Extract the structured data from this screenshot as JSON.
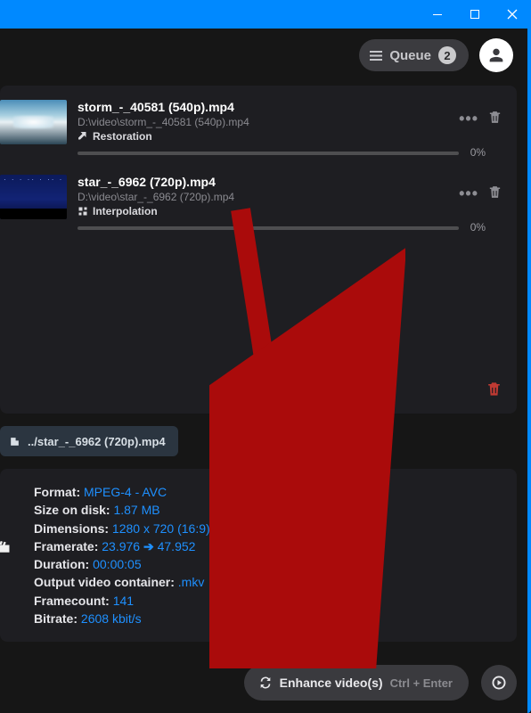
{
  "toolbar": {
    "queue_label": "Queue",
    "queue_count": "2"
  },
  "items": [
    {
      "name": "storm_-_40581 (540p).mp4",
      "path": "D:\\video\\storm_-_40581 (540p).mp4",
      "mode": "Restoration",
      "progress": "0%"
    },
    {
      "name": "star_-_6962 (720p).mp4",
      "path": "D:\\video\\star_-_6962 (720p).mp4",
      "mode": "Interpolation",
      "progress": "0%"
    }
  ],
  "selected_file": "../star_-_6962 (720p).mp4",
  "details": {
    "format_label": "Format:",
    "format": "MPEG-4 - AVC",
    "size_label": "Size on disk:",
    "size": "1.87 MB",
    "dim_label": "Dimensions:",
    "dim": "1280 x 720 (16:9)",
    "fps_label": "Framerate:",
    "fps_from": "23.976",
    "fps_to": "47.952",
    "dur_label": "Duration:",
    "dur": "00:00:05",
    "container_label": "Output video container:",
    "container": ".mkv",
    "fc_label": "Framecount:",
    "fc": "141",
    "br_label": "Bitrate:",
    "br": "2608 kbit/s"
  },
  "actions": {
    "enhance": "Enhance video(s)",
    "shortcut": "Ctrl + Enter"
  }
}
